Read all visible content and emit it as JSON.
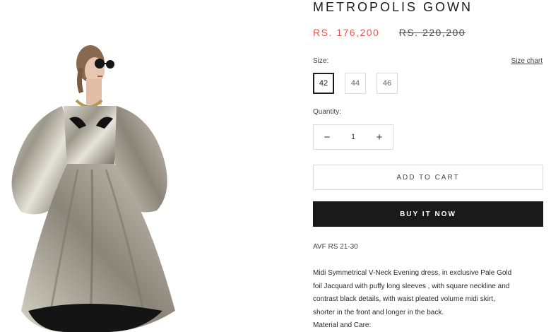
{
  "product": {
    "title": "METROPOLIS GOWN",
    "price_sale": "RS. 176,200",
    "price_compare": "RS. 220,200",
    "image_icon": "product-photo"
  },
  "size": {
    "label": "Size:",
    "chart_link": "Size chart",
    "options": [
      "42",
      "44",
      "46"
    ],
    "selected": "42"
  },
  "quantity": {
    "label": "Quantity:",
    "value": "1",
    "decrease": "−",
    "increase": "+"
  },
  "actions": {
    "add_to_cart": "ADD TO CART",
    "buy_now": "BUY IT NOW"
  },
  "avf": "AVF RS 21-30",
  "description": {
    "lines": [
      "Midi Symmetrical V-Neck Evening dress, in exclusive Pale Gold",
      "foil Jacquard with puffy long sleeves , with square neckline and",
      "contrast black details, with waist pleated volume midi skirt,",
      "shorter in the front and longer in the back.",
      "Material and Care:"
    ]
  },
  "colors": {
    "sale": "#e8564f",
    "buy_now_bg": "#1a1a1a",
    "border": "#dcdcdc"
  }
}
